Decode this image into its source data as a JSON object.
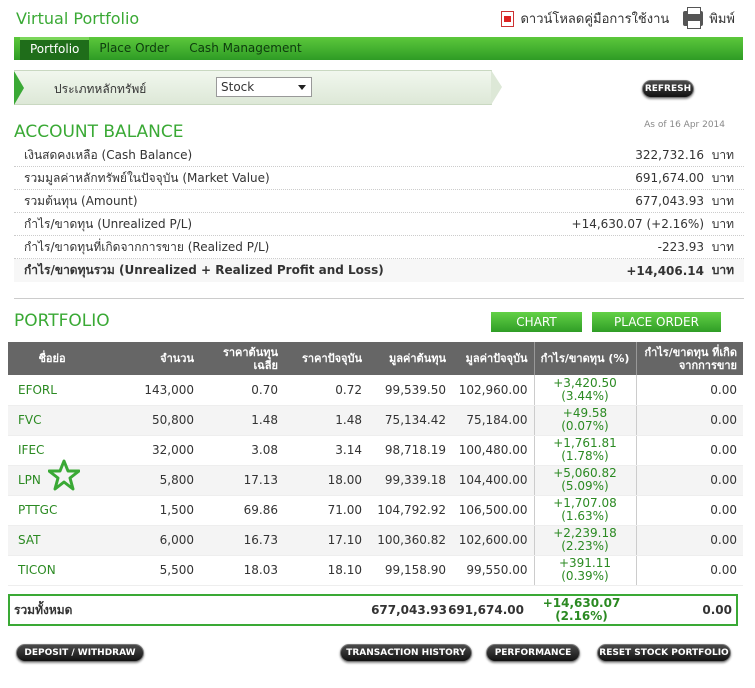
{
  "header": {
    "title": "Virtual Portfolio",
    "download_manual": "ดาวน์โหลดคู่มือการใช้งาน",
    "print": "พิมพ์"
  },
  "nav": {
    "tabs": [
      {
        "label": "Portfolio",
        "active": true
      },
      {
        "label": "Place Order",
        "active": false
      },
      {
        "label": "Cash Management",
        "active": false
      }
    ]
  },
  "filter": {
    "label": "ประเภทหลักทรัพย์",
    "selected": "Stock",
    "refresh_label": "REFRESH"
  },
  "account_balance": {
    "title": "ACCOUNT BALANCE",
    "as_of": "As of 16 Apr 2014",
    "rows": [
      {
        "label": "เงินสดคงเหลือ (Cash Balance)",
        "value": "322,732.16",
        "unit": "บาท"
      },
      {
        "label": "รวมมูลค่าหลักทรัพย์ในปัจจุบัน (Market Value)",
        "value": "691,674.00",
        "unit": "บาท"
      },
      {
        "label": "รวมต้นทุน (Amount)",
        "value": "677,043.93",
        "unit": "บาท"
      },
      {
        "label": "กำไร/ขาดทุน (Unrealized P/L)",
        "value": "+14,630.07 (+2.16%)",
        "unit": "บาท"
      },
      {
        "label": "กำไร/ขาดทุนที่เกิดจากการขาย (Realized P/L)",
        "value": "-223.93",
        "unit": "บาท"
      },
      {
        "label": "กำไร/ขาดทุนรวม (Unrealized + Realized Profit and Loss)",
        "value": "+14,406.14",
        "unit": "บาท"
      }
    ]
  },
  "portfolio": {
    "title": "PORTFOLIO",
    "chart_button": "CHART",
    "place_order_button": "PLACE ORDER",
    "columns": [
      "ชื่อย่อ",
      "จำนวน",
      "ราคาต้นทุนเฉลี่ย",
      "ราคาปัจจุบัน",
      "มูลค่าต้นทุน",
      "มูลค่าปัจจุบัน",
      "กำไร/ขาดทุน (%)",
      "กำไร/ขาดทุน ที่เกิดจากการขาย"
    ],
    "rows": [
      {
        "symbol": "EFORL",
        "qty": "143,000",
        "avg_cost": "0.70",
        "price": "0.72",
        "cost_value": "99,539.50",
        "market_value": "102,960.00",
        "pl": "+3,420.50",
        "pl_pct": "(3.44%)",
        "realized": "0.00"
      },
      {
        "symbol": "FVC",
        "qty": "50,800",
        "avg_cost": "1.48",
        "price": "1.48",
        "cost_value": "75,134.42",
        "market_value": "75,184.00",
        "pl": "+49.58",
        "pl_pct": "(0.07%)",
        "realized": "0.00"
      },
      {
        "symbol": "IFEC",
        "qty": "32,000",
        "avg_cost": "3.08",
        "price": "3.14",
        "cost_value": "98,718.19",
        "market_value": "100,480.00",
        "pl": "+1,761.81",
        "pl_pct": "(1.78%)",
        "realized": "0.00"
      },
      {
        "symbol": "LPN",
        "qty": "5,800",
        "avg_cost": "17.13",
        "price": "18.00",
        "cost_value": "99,339.18",
        "market_value": "104,400.00",
        "pl": "+5,060.82",
        "pl_pct": "(5.09%)",
        "realized": "0.00"
      },
      {
        "symbol": "PTTGC",
        "qty": "1,500",
        "avg_cost": "69.86",
        "price": "71.00",
        "cost_value": "104,792.92",
        "market_value": "106,500.00",
        "pl": "+1,707.08",
        "pl_pct": "(1.63%)",
        "realized": "0.00"
      },
      {
        "symbol": "SAT",
        "qty": "6,000",
        "avg_cost": "16.73",
        "price": "17.10",
        "cost_value": "100,360.82",
        "market_value": "102,600.00",
        "pl": "+2,239.18",
        "pl_pct": "(2.23%)",
        "realized": "0.00"
      },
      {
        "symbol": "TICON",
        "qty": "5,500",
        "avg_cost": "18.03",
        "price": "18.10",
        "cost_value": "99,158.90",
        "market_value": "99,550.00",
        "pl": "+391.11",
        "pl_pct": "(0.39%)",
        "realized": "0.00"
      }
    ],
    "total": {
      "label": "รวมทั้งหมด",
      "cost_value": "677,043.93",
      "market_value": "691,674.00",
      "pl": "+14,630.07",
      "pl_pct": "(2.16%)",
      "realized": "0.00"
    }
  },
  "footer": {
    "deposit_withdraw": "DEPOSIT / WITHDRAW",
    "transaction_history": "TRANSACTION HISTORY",
    "performance": "PERFORMANCE",
    "reset_portfolio": "RESET STOCK PORTFOLIO"
  },
  "colors": {
    "brand_green": "#3aa935",
    "nav_active": "#1f6d1a",
    "negative": "#cc0000"
  }
}
